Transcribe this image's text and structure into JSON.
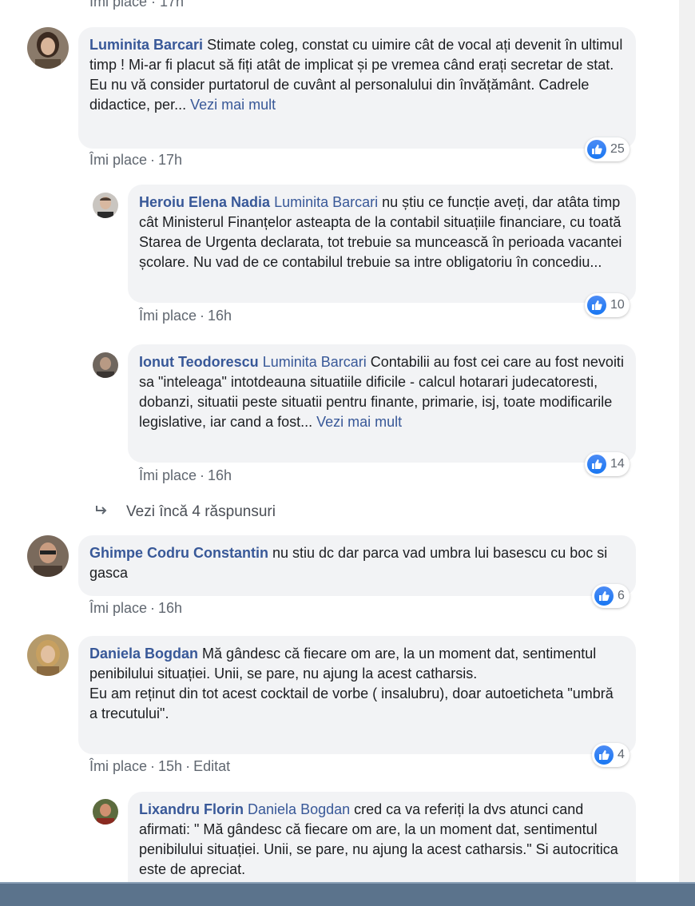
{
  "top_meta": "Îmi place · 17h",
  "comments": [
    {
      "author": "Luminita Barcari",
      "text": "Stimate coleg, constat cu uimire cât de vocal ați devenit în ultimul timp ! Mi-ar fi placut să fiți atât de implicat și pe vremea când erați secretar de stat. Eu nu vă consider purtatorul de cuvânt al personalului din învățământ. Cadrele didactice, per...",
      "see_more": "Vezi mai mult",
      "like": "Îmi place",
      "time": "17h",
      "reactions": "25"
    },
    {
      "author": "Heroiu Elena Nadia",
      "mention": "Luminita Barcari",
      "text": "nu știu ce funcție aveți, dar atâta timp cât Ministerul Finanțelor asteapta de la contabil situațiile financiare, cu toată Starea de Urgenta declarata, tot trebuie sa muncească în perioada vacantei școlare. Nu vad de ce contabilul trebuie sa intre obligatoriu în concediu...",
      "like": "Îmi place",
      "time": "16h",
      "reactions": "10"
    },
    {
      "author": "Ionut Teodorescu",
      "mention": "Luminita Barcari",
      "text": "Contabilii au fost cei care au fost nevoiti sa \"inteleaga\" intotdeauna situatiile dificile - calcul hotarari judecatoresti, dobanzi, situatii peste situatii pentru finante, primarie, isj, toate modificarile legislative, iar cand a fost...",
      "see_more": "Vezi mai mult",
      "like": "Îmi place",
      "time": "16h",
      "reactions": "14"
    },
    {
      "author": "Ghimpe Codru Constantin",
      "text": "nu stiu dc dar parca vad umbra lui basescu cu boc si gasca",
      "like": "Îmi place",
      "time": "16h",
      "reactions": "6"
    },
    {
      "author": "Daniela Bogdan",
      "text": "Mă gândesc că fiecare om are, la un moment dat, sentimentul penibilului situației. Unii, se pare, nu ajung la acest catharsis.",
      "text2": "Eu am reținut din tot acest cocktail de vorbe ( insalubru), doar autoeticheta \"umbră a trecutului\".",
      "like": "Îmi place",
      "time": "15h",
      "edited": "Editat",
      "reactions": "4"
    },
    {
      "author": "Lixandru Florin",
      "mention": "Daniela Bogdan",
      "text": "cred ca va referiți la dvs atunci cand afirmati: \" Mă gândesc că fiecare om are, la un moment dat, sentimentul penibilului situației. Unii, se pare, nu ajung la acest catharsis.\" Si autocritica este de apreciat."
    }
  ],
  "view_more_replies": "Vezi încă 4 răspunsuri",
  "colors": {
    "link": "#385898",
    "bubble": "#f2f3f5",
    "like_blue": "#1877f2",
    "meta": "#606770"
  }
}
